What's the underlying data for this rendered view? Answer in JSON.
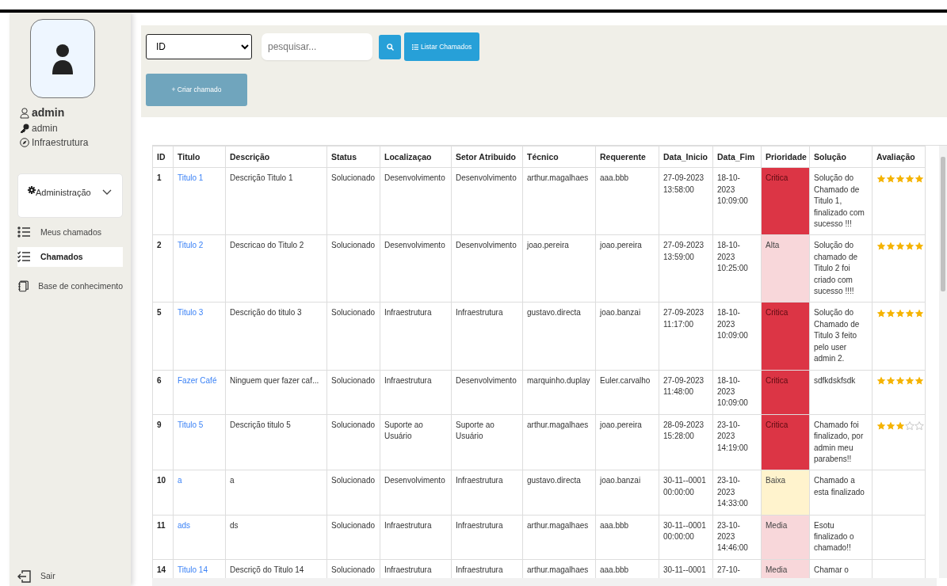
{
  "sidebar": {
    "user": {
      "name": "admin",
      "role": "admin",
      "sector": "Infraestrutura"
    },
    "admin_menu": {
      "label": "Administração",
      "expanded": false
    },
    "items": [
      {
        "label": "Meus chamados",
        "selected": false
      },
      {
        "label": "Chamados",
        "selected": true
      },
      {
        "label": "Base de conhecimento",
        "selected": false
      }
    ],
    "logout": "Sair"
  },
  "toolbar": {
    "filter": {
      "value": "ID"
    },
    "search": {
      "placeholder": "pesquisar..."
    },
    "list_button": "Listar Chamados",
    "create_button": "+ Criar chamado"
  },
  "table": {
    "columns": [
      "ID",
      "Titulo",
      "Descrição",
      "Status",
      "Localizaçao",
      "Setor Atribuido",
      "Técnico",
      "Requerente",
      "Data_Inicio",
      "Data_Fim",
      "Prioridade",
      "Solução",
      "Avaliação"
    ],
    "rows": [
      {
        "id": "1",
        "title": "Titulo 1",
        "description": "Descrição Titulo 1",
        "status": "Solucionado",
        "location": "Desenvolvimento",
        "sector": "Desenvolvimento",
        "technician": "arthur.magalhaes",
        "requester": "aaa.bbb",
        "start": "27-09-2023 13:58:00",
        "end": "18-10-2023 10:09:00",
        "priority": {
          "label": "Critica",
          "color": "#dc3545"
        },
        "solution": "Solução do Chamado de Titulo 1, finalizado com sucesso !!!",
        "stars": 5
      },
      {
        "id": "2",
        "title": "Titulo 2",
        "description": "Descricao do Titulo 2",
        "status": "Solucionado",
        "location": "Desenvolvimento",
        "sector": "Desenvolvimento",
        "technician": "joao.pereira",
        "requester": "joao.pereira",
        "start": "27-09-2023 13:59:00",
        "end": "18-10-2023 10:25:00",
        "priority": {
          "label": "Alta",
          "color": "#f8d7da"
        },
        "solution": "Solução do chamado de Titulo 2 foi criado com sucesso !!!!",
        "stars": 5
      },
      {
        "id": "5",
        "title": "Titulo 3",
        "description": "Descrição do titulo 3",
        "status": "Solucionado",
        "location": "Infraestrutura",
        "sector": "Infraestrutura",
        "technician": "gustavo.directa",
        "requester": "joao.banzai",
        "start": "27-09-2023 11:17:00",
        "end": "18-10-2023 10:09:00",
        "priority": {
          "label": "Critica",
          "color": "#dc3545"
        },
        "solution": "Solução do Chamado de Titulo 3 feito pelo user admin 2.",
        "stars": 5
      },
      {
        "id": "6",
        "title": "Fazer Café",
        "description": "Ninguem quer fazer caf...",
        "status": "Solucionado",
        "location": "Infraestrutura",
        "sector": "Desenvolvimento",
        "technician": "marquinho.duplay",
        "requester": "Euler.carvalho",
        "start": "27-09-2023 11:48:00",
        "end": "18-10-2023 10:09:00",
        "priority": {
          "label": "Critica",
          "color": "#dc3545"
        },
        "solution": "sdfkdskfsdk",
        "stars": 5
      },
      {
        "id": "9",
        "title": "Titulo 5",
        "description": "Descrição titulo 5",
        "status": "Solucionado",
        "location": "Suporte ao Usuário",
        "sector": "Suporte ao Usuário",
        "technician": "arthur.magalhaes",
        "requester": "joao.pereira",
        "start": "28-09-2023 15:28:00",
        "end": "23-10-2023 14:19:00",
        "priority": {
          "label": "Critica",
          "color": "#dc3545"
        },
        "solution": "Chamado foi finalizado, por admin meu parabens!!",
        "stars": 3
      },
      {
        "id": "10",
        "title": "a",
        "description": "a",
        "status": "Solucionado",
        "location": "Desenvolvimento",
        "sector": "Infraestrutura",
        "technician": "gustavo.directa",
        "requester": "joao.banzai",
        "start": "30-11--0001 00:00:00",
        "end": "23-10-2023 14:33:00",
        "priority": {
          "label": "Baixa",
          "color": "#fff3cd"
        },
        "solution": "Chamado a esta finalizado"
      },
      {
        "id": "11",
        "title": "ads",
        "description": "ds",
        "status": "Solucionado",
        "location": "Infraestrutura",
        "sector": "Infraestrutura",
        "technician": "arthur.magalhaes",
        "requester": "aaa.bbb",
        "start": "30-11--0001 00:00:00",
        "end": "23-10-2023 14:46:00",
        "priority": {
          "label": "Media",
          "color": "#f8d7da"
        },
        "solution": "Esotu finalizado o chamado!!"
      },
      {
        "id": "14",
        "title": "Titulo 14",
        "description": "Descriçõ do Titulo 14",
        "status": "Solucionado",
        "location": "Infraestrutura",
        "sector": "Infraestrutura",
        "technician": "arthur.magalhaes",
        "requester": "aaa.bbb",
        "start": "30-11--0001",
        "end": "27-10-",
        "priority": {
          "label": "Media",
          "color": "#f8d7da"
        },
        "solution": "Chamar o"
      }
    ]
  }
}
